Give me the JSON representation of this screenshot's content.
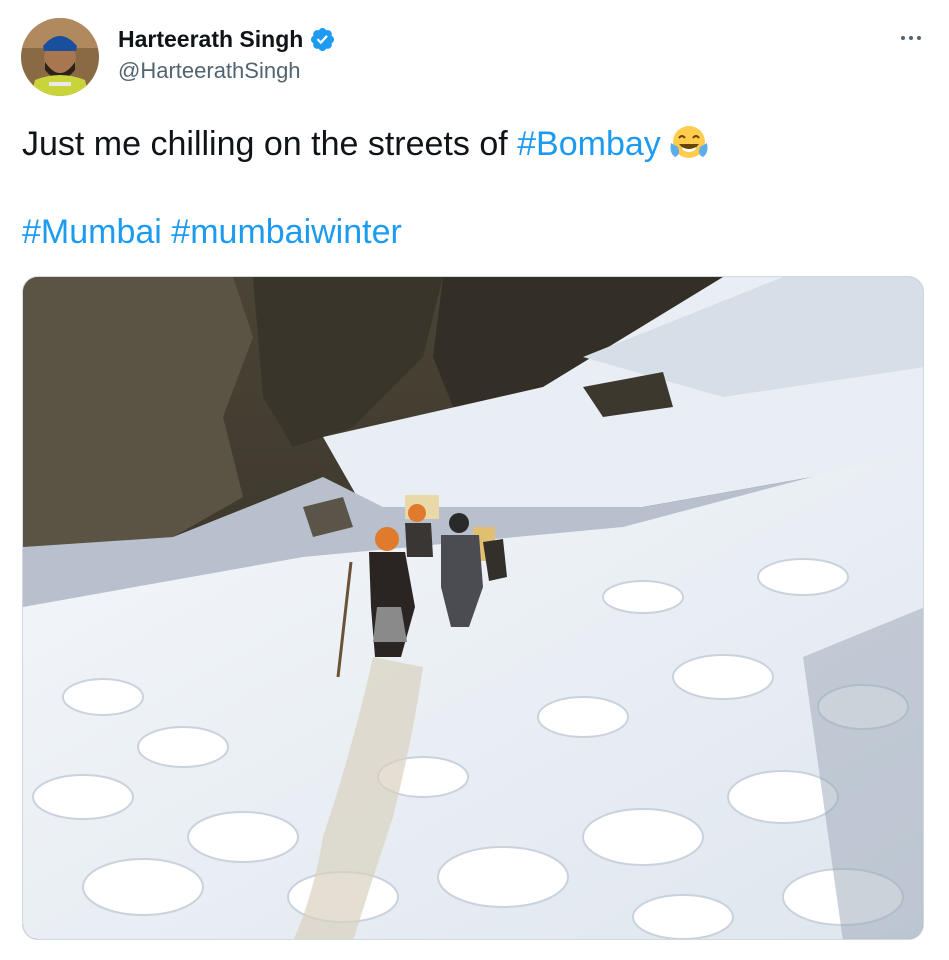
{
  "tweet": {
    "author": {
      "display_name": "Harteerath Singh",
      "handle": "@HarteerathSingh",
      "verified": true,
      "avatar_icon": "profile-photo"
    },
    "more_icon": "more-options-icon",
    "text": {
      "line1_prefix": "Just me chilling on the streets of ",
      "line1_hashtag": "#Bombay",
      "line1_emoji": "face-with-tears-of-joy-icon",
      "line2_hashtags": [
        "#Mumbai",
        "#mumbaiwinter"
      ]
    },
    "media": {
      "kind": "photo",
      "alt_icon": "snowy-mountain-trek-photo"
    },
    "colors": {
      "link": "#1d9bf0",
      "verified_badge": "#1d9bf0",
      "secondary_text": "#536471",
      "primary_text": "#0f1419",
      "media_border": "#cfd9de"
    }
  }
}
